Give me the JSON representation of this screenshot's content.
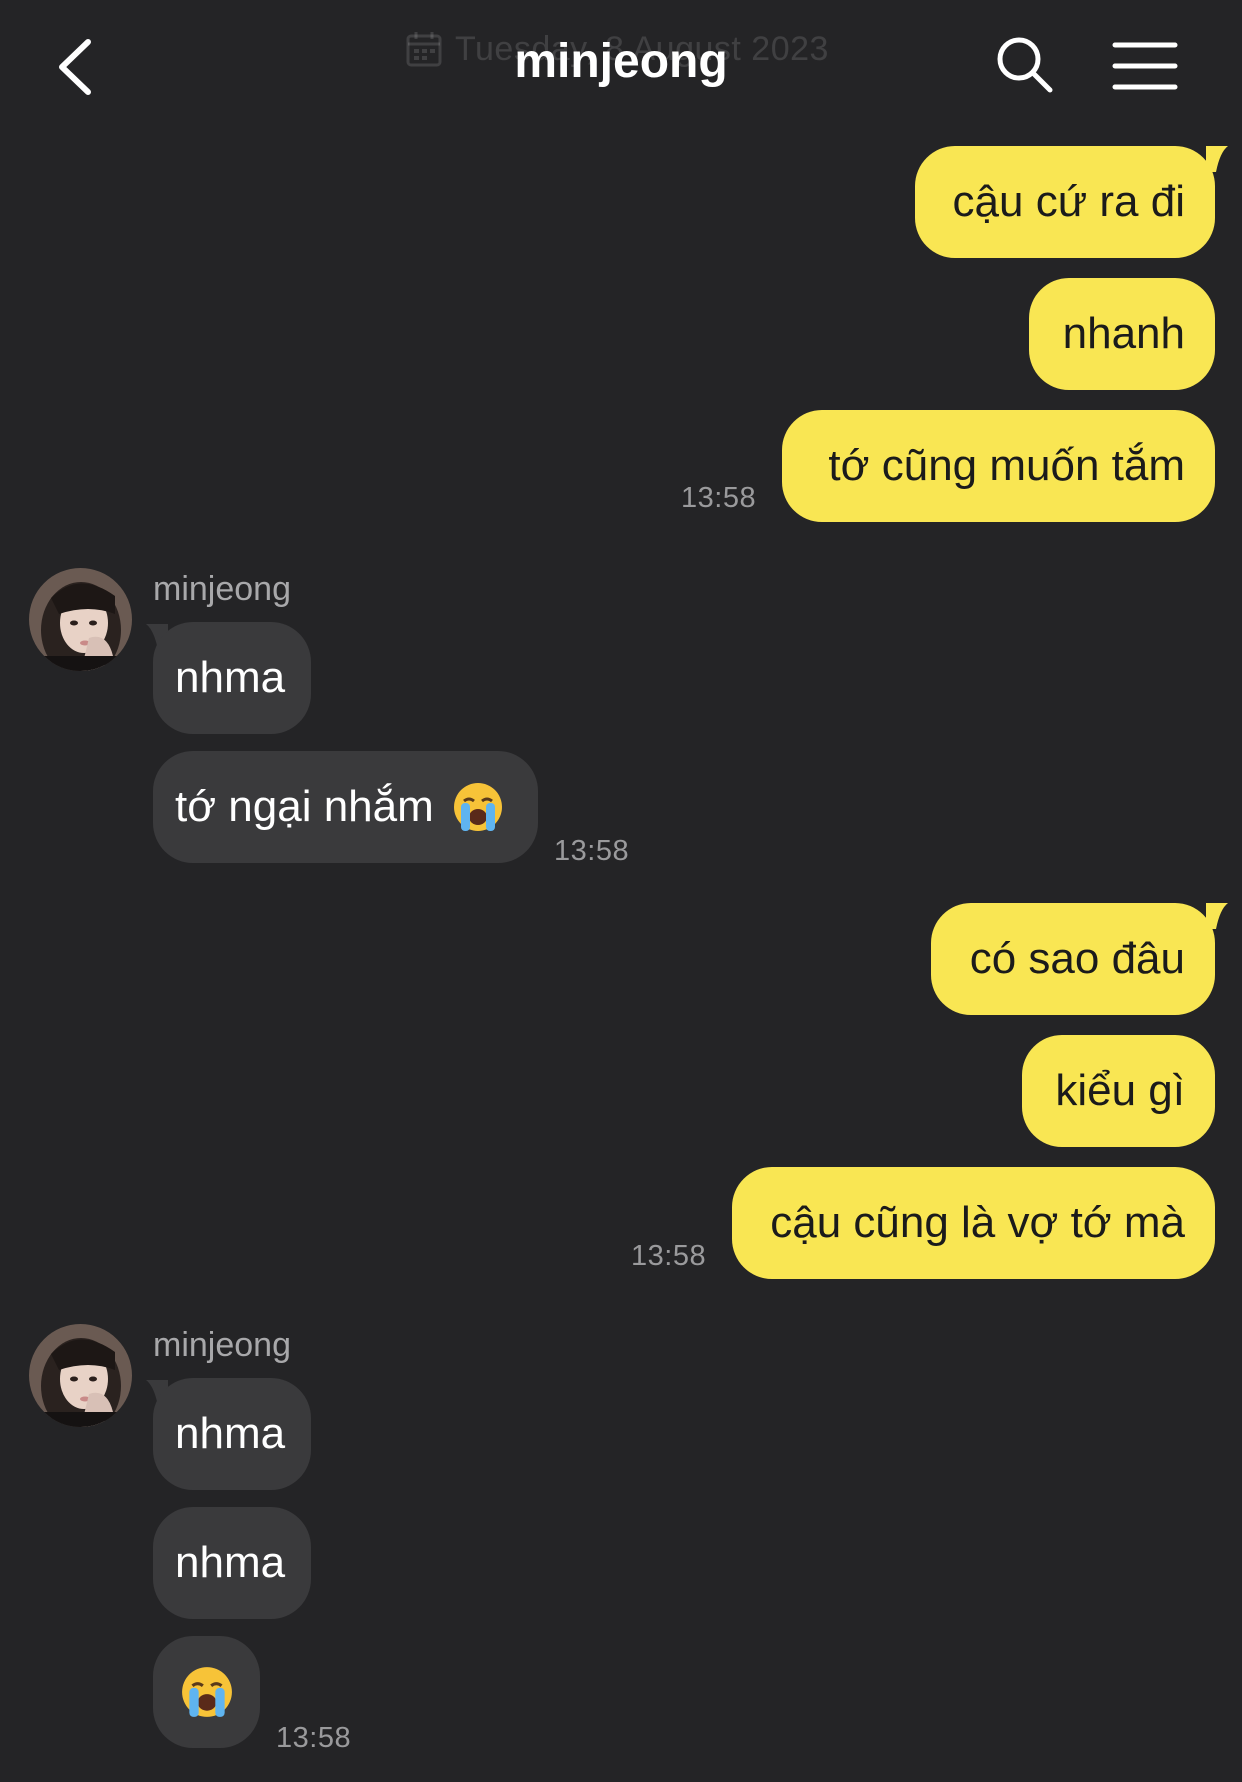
{
  "header": {
    "date": "Tuesday, 8 August 2023",
    "title": "minjeong",
    "icons": [
      "chevron-left-icon",
      "calendar-icon",
      "search-icon",
      "menu-icon"
    ]
  },
  "colors": {
    "background": "#242426",
    "outgoing_bubble": "#f9e653",
    "incoming_bubble": "#3a3a3c",
    "timestamp": "#9a9a9c"
  },
  "messages": {
    "m1": "cậu cứ ra đi",
    "m2": "nhanh",
    "m3": "tớ cũng muốn tắm",
    "t1": "13:58",
    "sender1": "minjeong",
    "m4": "nhma",
    "m5": "tớ ngại nhắm",
    "m5_emoji": "loudly-crying-face-emoji",
    "t2": "13:58",
    "m6": "có sao đâu",
    "m7": "kiểu gì",
    "m8": "cậu cũng là vợ tớ mà",
    "t3": "13:58",
    "sender2": "minjeong",
    "m9": "nhma",
    "m10": "nhma",
    "m11_emoji": "loudly-crying-face-emoji",
    "t4": "13:58"
  }
}
